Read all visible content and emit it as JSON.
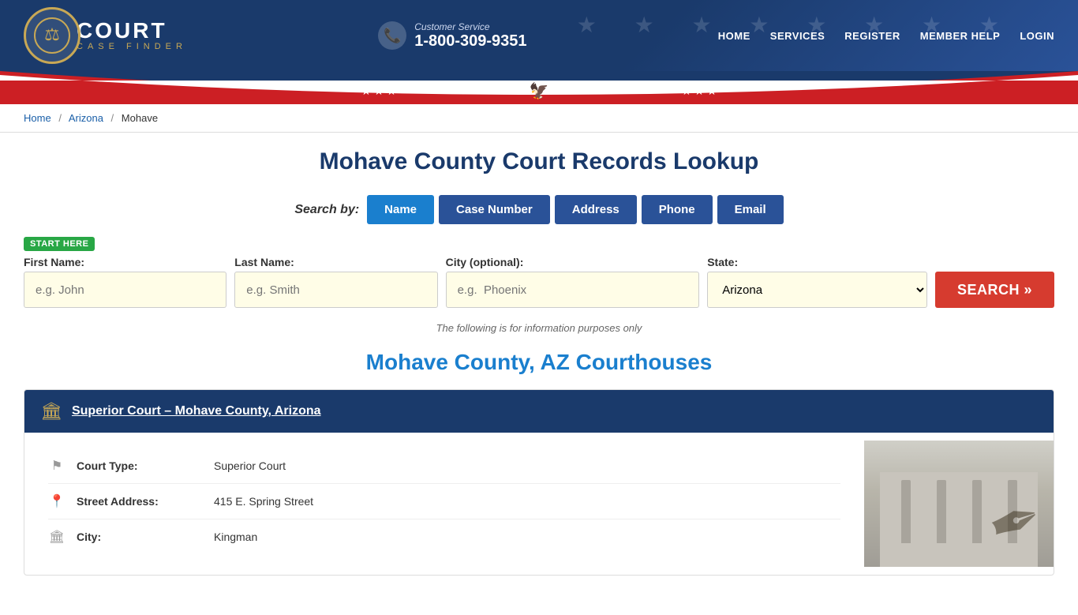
{
  "header": {
    "logo_court": "COURT",
    "logo_case_finder": "CASE FINDER",
    "cs_label": "Customer Service",
    "cs_phone": "1-800-309-9351",
    "nav": {
      "home": "HOME",
      "services": "SERVICES",
      "register": "REGISTER",
      "member_help": "MEMBER HELP",
      "login": "LOGIN"
    }
  },
  "breadcrumb": {
    "home": "Home",
    "state": "Arizona",
    "county": "Mohave"
  },
  "page": {
    "title": "Mohave County Court Records Lookup",
    "info_note": "The following is for information purposes only",
    "courthouses_title": "Mohave County, AZ Courthouses"
  },
  "search": {
    "by_label": "Search by:",
    "tabs": [
      {
        "id": "name",
        "label": "Name",
        "active": true
      },
      {
        "id": "case_number",
        "label": "Case Number",
        "active": false
      },
      {
        "id": "address",
        "label": "Address",
        "active": false
      },
      {
        "id": "phone",
        "label": "Phone",
        "active": false
      },
      {
        "id": "email",
        "label": "Email",
        "active": false
      }
    ],
    "start_here": "START HERE",
    "fields": {
      "first_name_label": "First Name:",
      "first_name_placeholder": "e.g. John",
      "last_name_label": "Last Name:",
      "last_name_placeholder": "e.g. Smith",
      "city_label": "City (optional):",
      "city_placeholder": "e.g.  Phoenix",
      "state_label": "State:",
      "state_value": "Arizona"
    },
    "search_button": "SEARCH »"
  },
  "courthouse": {
    "name": "Superior Court – Mohave County, Arizona",
    "details": [
      {
        "icon": "⚑",
        "label": "Court Type:",
        "value": "Superior Court"
      },
      {
        "icon": "📍",
        "label": "Street Address:",
        "value": "415 E. Spring Street"
      },
      {
        "icon": "🏛",
        "label": "City:",
        "value": "Kingman"
      }
    ]
  }
}
